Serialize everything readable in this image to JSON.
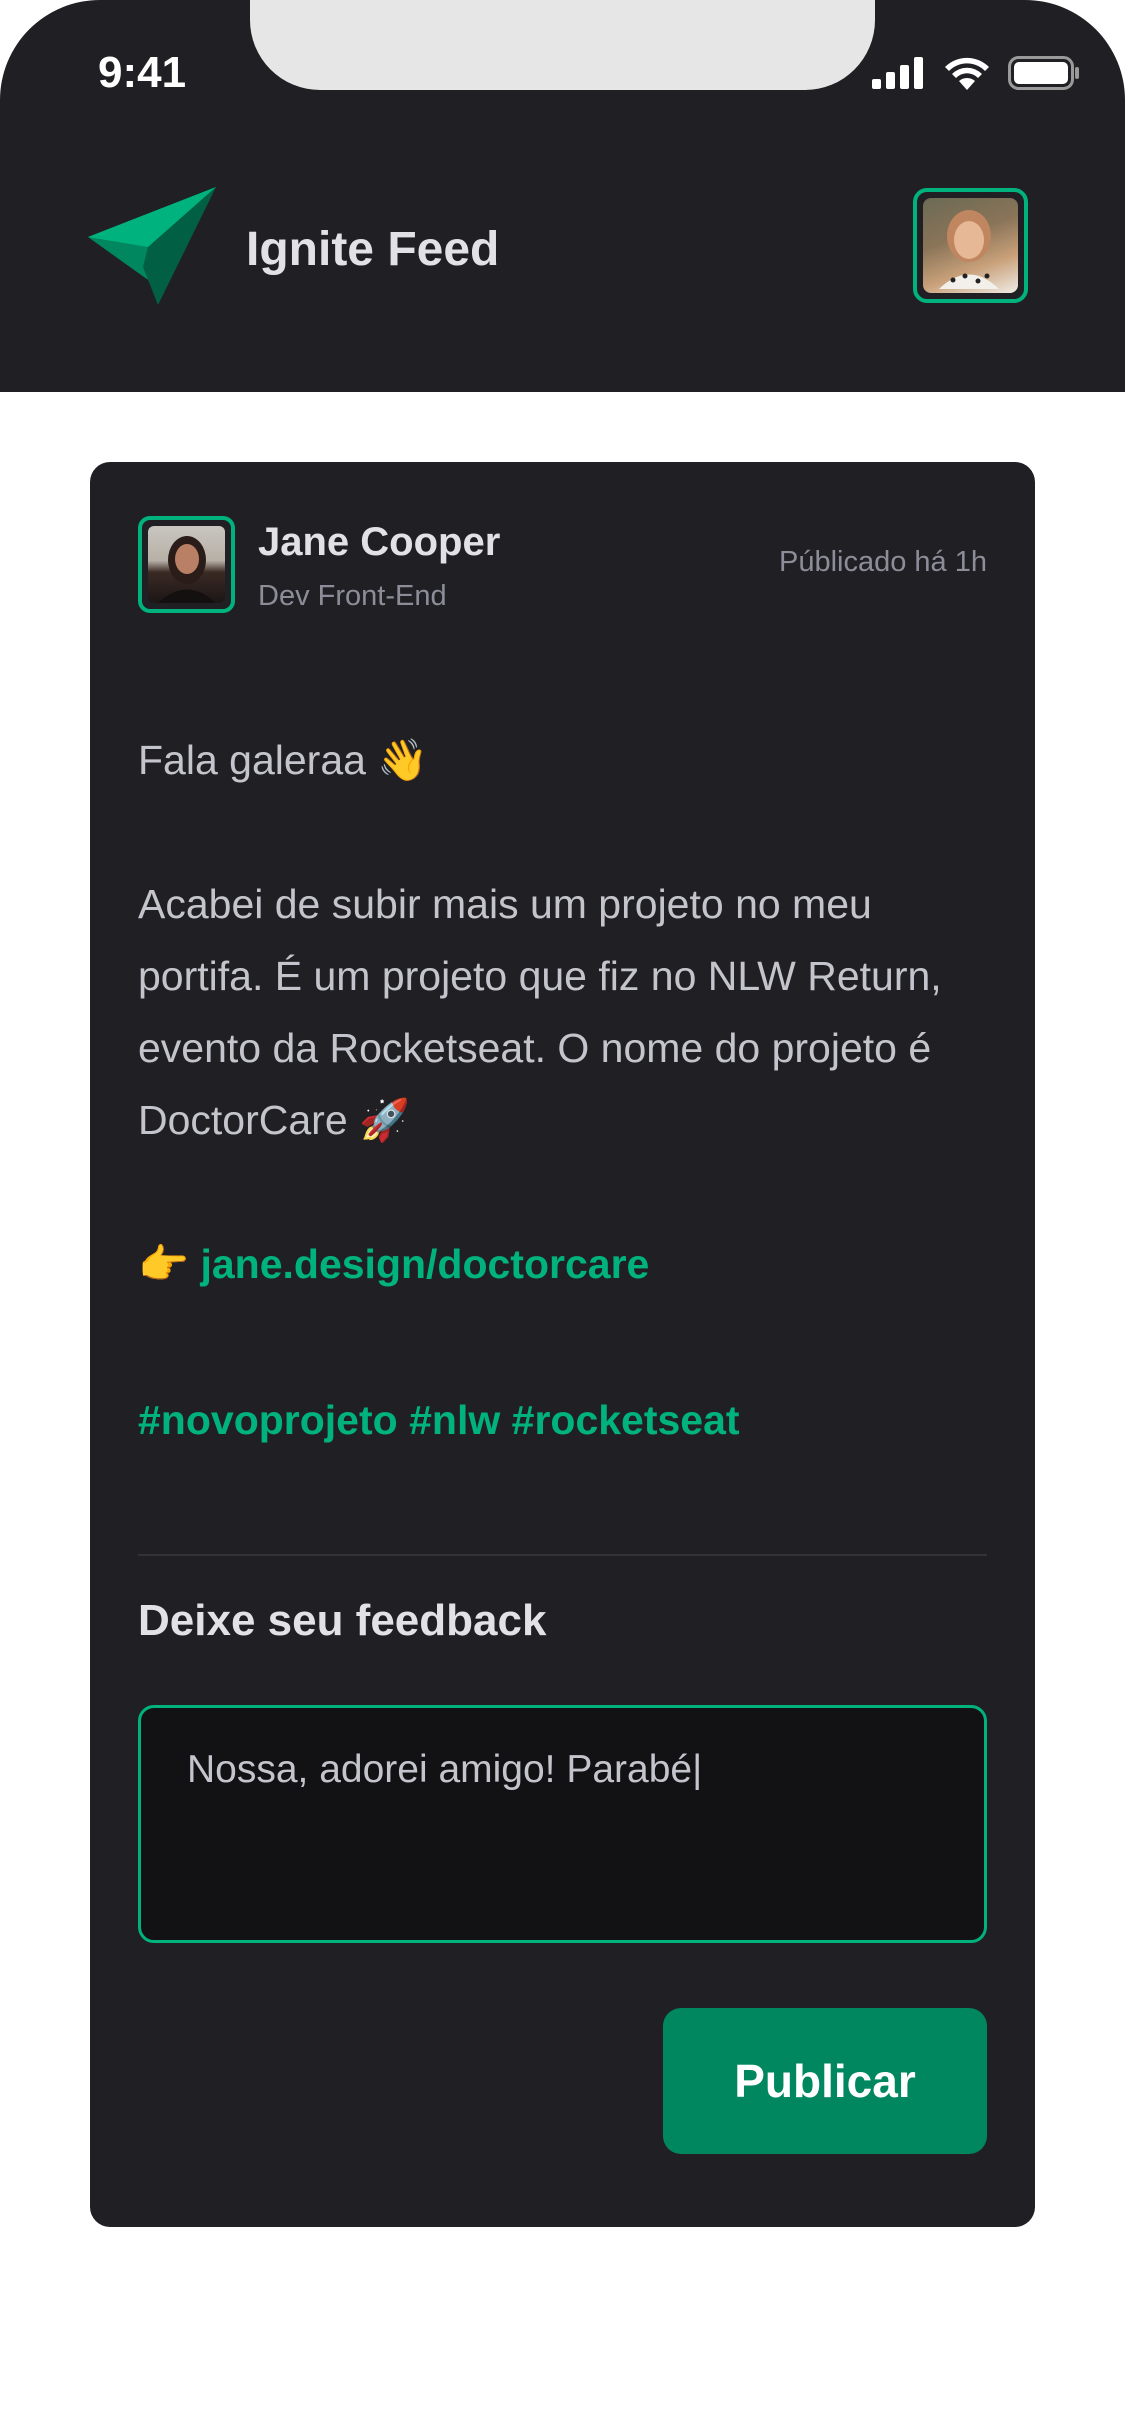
{
  "status_bar": {
    "time": "9:41",
    "icons": [
      "cellular-signal-icon",
      "wifi-icon",
      "battery-icon"
    ]
  },
  "header": {
    "title": "Ignite Feed",
    "logo_icon": "paper-plane-logo-icon",
    "avatar": "user-avatar"
  },
  "post": {
    "author": {
      "name": "Jane Cooper",
      "role": "Dev Front-End"
    },
    "published": "Públicado há 1h",
    "greeting": "Fala galeraa 👋",
    "body": "Acabei de subir mais um projeto no meu portifa. É um projeto que fiz no NLW Return, evento da Rocketseat. O nome do projeto é DoctorCare 🚀",
    "link_prefix": "👉",
    "link": "jane.design/doctorcare",
    "hashtags": [
      "#novoprojeto",
      "#nlw",
      "#rocketseat"
    ]
  },
  "feedback": {
    "title": "Deixe seu feedback",
    "value": "Nossa, adorei amigo! Parabé",
    "button": "Publicar"
  },
  "colors": {
    "accent": "#00b37e",
    "button": "#00875f",
    "card": "#202024",
    "input": "#121214"
  }
}
